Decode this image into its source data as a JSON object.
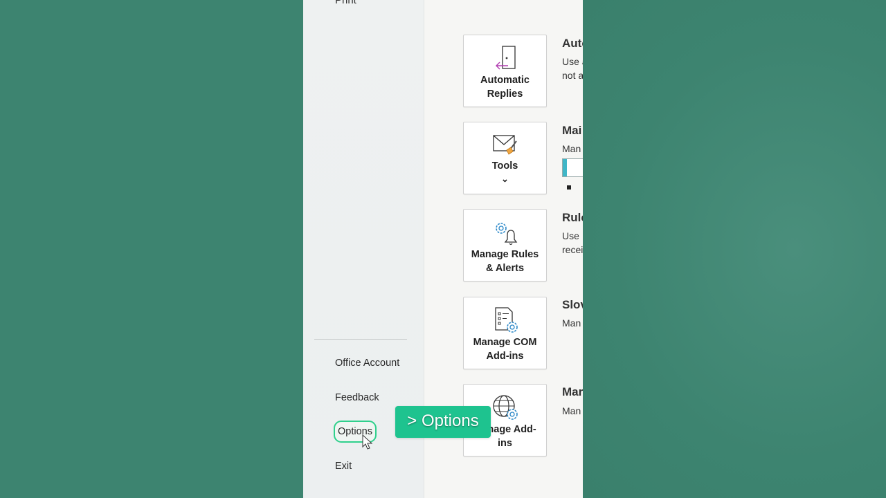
{
  "sidebar": {
    "partial_top_item": "Print",
    "items": [
      {
        "label": "Office Account"
      },
      {
        "label": "Feedback"
      },
      {
        "label": "Options"
      },
      {
        "label": "Exit"
      }
    ]
  },
  "cards": [
    {
      "line1": "Automatic",
      "line2": "Replies",
      "icon": "door-arrow-icon"
    },
    {
      "line1": "Tools",
      "line2": "⌄",
      "icon": "mail-broom-icon"
    },
    {
      "line1": "Manage Rules",
      "line2": "& Alerts",
      "icon": "gear-bell-icon"
    },
    {
      "line1": "Manage COM",
      "line2": "Add-ins",
      "icon": "document-gear-icon"
    },
    {
      "line1": "Manage Add-",
      "line2": "ins",
      "icon": "globe-gear-icon"
    }
  ],
  "sections": [
    {
      "title": "Auto",
      "text1": "Use a",
      "text2": "not a"
    },
    {
      "title": "Mai",
      "text1": "Man"
    },
    {
      "title": "Rule",
      "text1": "Use",
      "text2": "recei"
    },
    {
      "title": "Slov",
      "text1": "Man"
    },
    {
      "title": "Mar",
      "text1": "Man"
    }
  ],
  "caption": {
    "text": "> Options"
  },
  "colors": {
    "accent": "#2fd08c",
    "caption_bg": "#1ec38f",
    "background": "#3d8470"
  }
}
